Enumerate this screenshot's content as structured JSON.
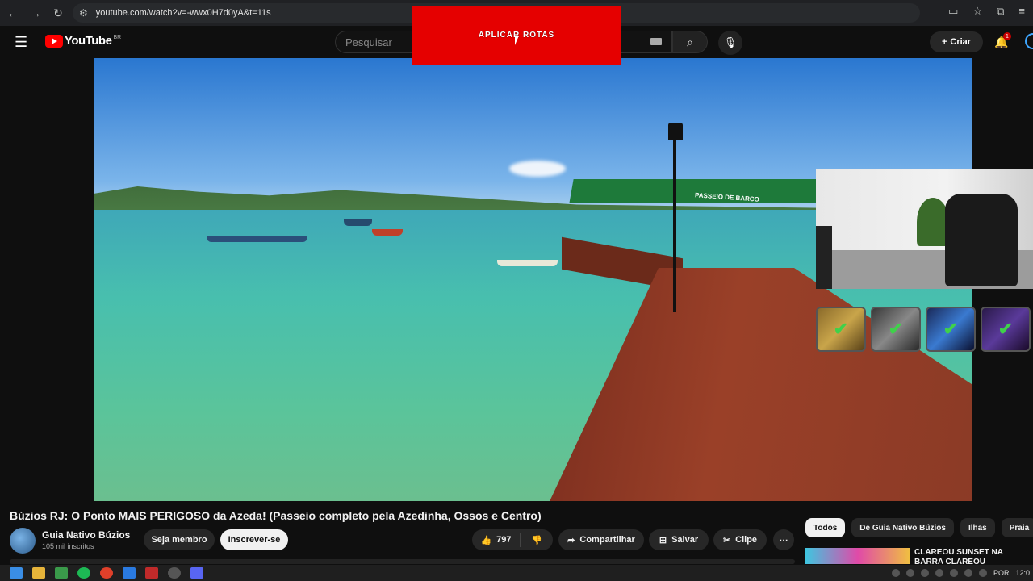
{
  "browser": {
    "url": "youtube.com/watch?v=-wwx0H7d0yA&t=11s",
    "back_icon": "back-arrow-icon",
    "forward_icon": "forward-arrow-icon",
    "reload_icon": "reload-icon"
  },
  "header": {
    "logo_text": "YouTube",
    "region": "BR",
    "search_placeholder": "Pesquisar",
    "create_label": "Criar",
    "notification_count": "1"
  },
  "overlay_banner": {
    "text": "APLICAR ROTAS"
  },
  "player": {
    "sign_text": "PASSEIO DE BARCO"
  },
  "video": {
    "title": "Búzios RJ: O Ponto MAIS PERIGOSO da Azeda! (Passeio completo pela Azedinha, Ossos e Centro)",
    "channel_name": "Guia Nativo Búzios",
    "subscribers": "105 mil inscritos",
    "member_label": "Seja membro",
    "subscribe_label": "Inscrever-se",
    "likes": "797",
    "share_label": "Compartilhar",
    "save_label": "Salvar",
    "clip_label": "Clipe"
  },
  "sidebar": {
    "chips": [
      "Todos",
      "De Guia Nativo Búzios",
      "Ilhas",
      "Praia"
    ],
    "rec_title": "CLAREOU SUNSET NA BARRA CLAREOU"
  },
  "taskbar": {
    "lang": "POR",
    "time": "12:0"
  },
  "colors": {
    "accent_red": "#ff0000",
    "banner_red": "#e50000",
    "check_green": "#3fd14a"
  }
}
